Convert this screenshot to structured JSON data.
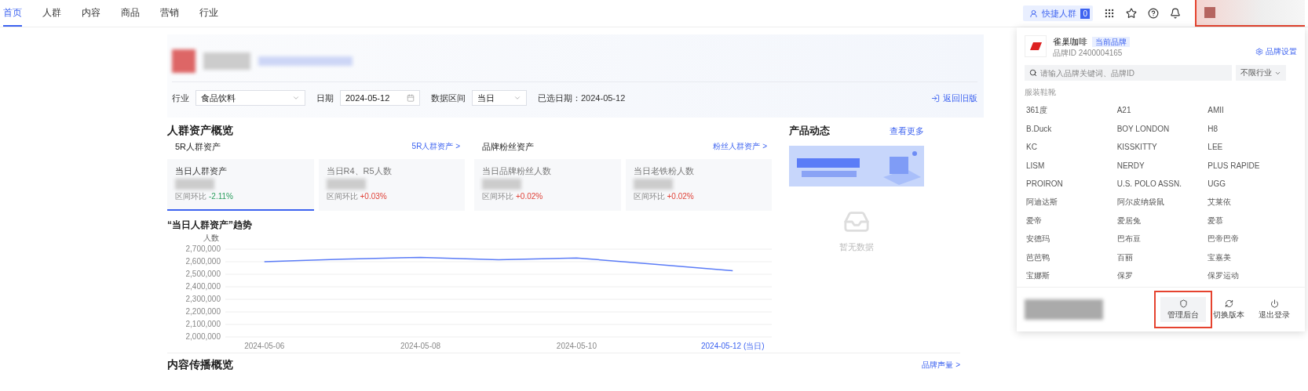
{
  "nav": {
    "tabs": [
      {
        "label": "首页",
        "selected": true
      },
      {
        "label": "人群",
        "selected": false
      },
      {
        "label": "内容",
        "selected": false
      },
      {
        "label": "商品",
        "selected": false
      },
      {
        "label": "营销",
        "selected": false
      },
      {
        "label": "行业",
        "selected": false
      }
    ],
    "quick_button": {
      "label": "快捷人群",
      "count": "0"
    },
    "avatar_highlighted": true
  },
  "header": {
    "filters": [
      {
        "label": "行业",
        "value": "食品饮料",
        "kind": "select"
      },
      {
        "label": "日期",
        "value": "2024-05-12",
        "kind": "date"
      },
      {
        "label": "数据区间",
        "value": "当日",
        "kind": "select"
      }
    ],
    "selected_date": "已选日期：2024-05-12",
    "back_link": "返回旧版"
  },
  "overview": {
    "title": "人群资产概览",
    "groups": [
      {
        "title": "5R人群资产",
        "link": "5R人群资产 >",
        "cards": [
          {
            "label": "当日人群资产",
            "delta_label": "区间环比",
            "delta": "-2.11%",
            "color": "#2a9d5c",
            "selected": true
          },
          {
            "label": "当日R4、R5人数",
            "delta_label": "区间环比",
            "delta": "+0.03%",
            "color": "#e0443a",
            "selected": false
          }
        ]
      },
      {
        "title": "品牌粉丝资产",
        "link": "粉丝人群资产 >",
        "cards": [
          {
            "label": "当日品牌粉丝人数",
            "delta_label": "区间环比",
            "delta": "+0.02%",
            "color": "#e0443a",
            "selected": false
          },
          {
            "label": "当日老铁粉人数",
            "delta_label": "区间环比",
            "delta": "+0.02%",
            "color": "#e0443a",
            "selected": false
          }
        ]
      }
    ]
  },
  "trend": {
    "title": "“当日人群资产”趋势",
    "chart_data": {
      "type": "line",
      "ylabel": "人数",
      "grid": true,
      "categories": [
        "2024-05-06",
        null,
        "2024-05-08",
        null,
        "2024-05-10",
        null,
        "2024-05-12 (当日)"
      ],
      "series": [
        {
          "color": "#5b7cf7",
          "values": [
            2600000,
            2620000,
            2635000,
            2615000,
            2630000,
            2580000,
            2528000
          ]
        }
      ],
      "ylim": [
        2000000,
        2700000
      ],
      "yticks": [
        {
          "value": 2000000,
          "label": "2,000,000"
        },
        {
          "value": 2100000,
          "label": "2,100,000"
        },
        {
          "value": 2200000,
          "label": "2,200,000"
        },
        {
          "value": 2300000,
          "label": "2,300,000"
        },
        {
          "value": 2400000,
          "label": "2,400,000"
        },
        {
          "value": 2500000,
          "label": "2,500,000"
        },
        {
          "value": 2600000,
          "label": "2,600,000"
        },
        {
          "value": 2700000,
          "label": "2,700,000"
        }
      ]
    }
  },
  "product": {
    "title": "产品动态",
    "more": "查看更多",
    "empty": "暂无数据"
  },
  "next_section": {
    "title": "内容传播概览",
    "link": "品牌声量 >"
  },
  "dropdown": {
    "brand_name": "雀巢咖啡",
    "badge": "当前品牌",
    "brand_id": "品牌ID 2400004165",
    "settings": "品牌设置",
    "search_placeholder": "请输入品牌关键词、品牌ID",
    "industry": "不限行业",
    "category": "服装鞋靴",
    "brands": [
      "361度",
      "A21",
      "AMII",
      "B.Duck",
      "BOY LONDON",
      "H8",
      "KC",
      "KISSKITTY",
      "LEE",
      "LISM",
      "NERDY",
      "PLUS RAPIDE",
      "PROIRON",
      "U.S. POLO ASSN.",
      "UGG",
      "阿迪达斯",
      "阿尔皮纳袋鼠",
      "艾莱依",
      "爱帝",
      "爱居兔",
      "爱慕",
      "安德玛",
      "巴布豆",
      "巴帝巴帝",
      "芭芭鸭",
      "百丽",
      "宝嘉美",
      "宝娜斯",
      "保罗",
      "保罗运动"
    ],
    "actions": [
      {
        "label": "管理后台",
        "kind": "admin",
        "highlighted": true
      },
      {
        "label": "切换版本",
        "kind": "switch",
        "highlighted": false
      },
      {
        "label": "退出登录",
        "kind": "logout",
        "highlighted": false
      }
    ]
  }
}
